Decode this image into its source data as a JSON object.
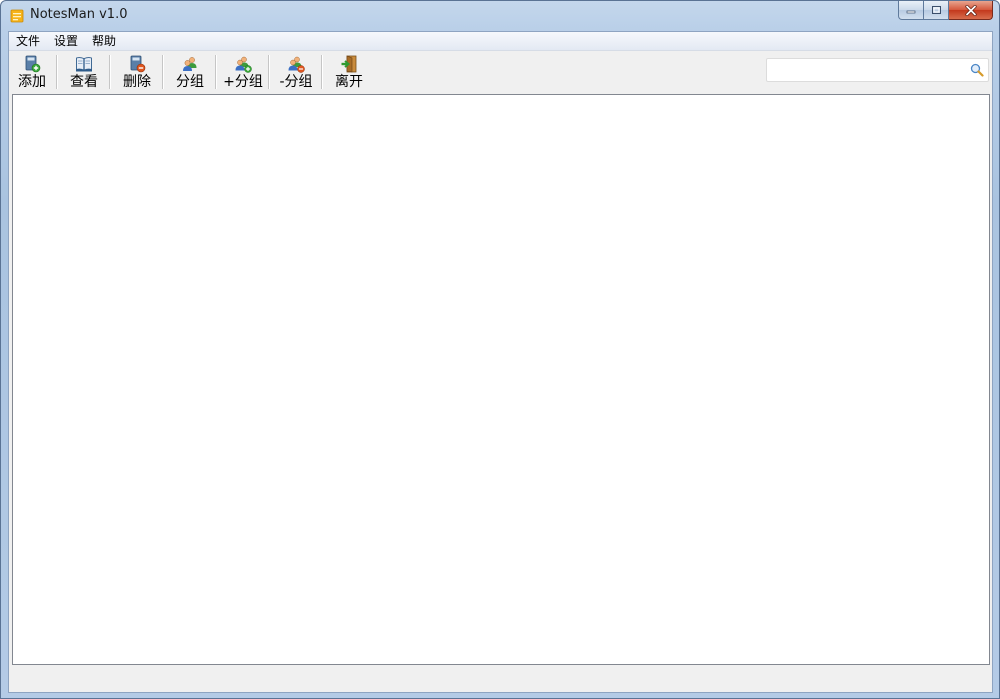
{
  "window": {
    "title": "NotesMan v1.0",
    "icons": {
      "app": "notes-app-icon",
      "minimize": "minimize-icon",
      "maximize": "maximize-icon",
      "close": "close-icon"
    }
  },
  "menu": {
    "items": [
      {
        "label": "文件"
      },
      {
        "label": "设置"
      },
      {
        "label": "帮助"
      }
    ]
  },
  "toolbar": {
    "buttons": [
      {
        "label": "添加",
        "icon": "add-note-icon"
      },
      {
        "label": "查看",
        "icon": "view-book-icon"
      },
      {
        "label": "删除",
        "icon": "delete-note-icon"
      },
      {
        "label": "分组",
        "icon": "group-users-icon"
      },
      {
        "label": "+分组",
        "icon": "add-group-icon"
      },
      {
        "label": "-分组",
        "icon": "remove-group-icon"
      },
      {
        "label": "离开",
        "icon": "exit-door-icon"
      }
    ]
  },
  "search": {
    "value": "",
    "placeholder": "",
    "icon": "search-icon"
  },
  "colors": {
    "title_bar": "#b9cfe8",
    "close_button": "#c3381c",
    "client_background": "#f0f0f0"
  }
}
